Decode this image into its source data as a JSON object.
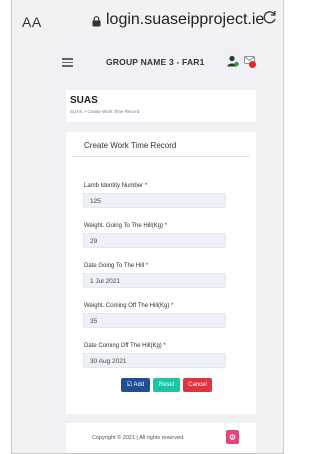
{
  "browser": {
    "aa_label": "AA",
    "url": "login.suaseipproject.ie"
  },
  "header": {
    "group_name": "GROUP NAME 3 -  FAR1"
  },
  "title_card": {
    "app_title": "SUAS",
    "breadcrumb": "SUAS   >  Create Work Time Record"
  },
  "form": {
    "title": "Create Work Time Record",
    "fields": [
      {
        "label": "Lamb Identity Number *",
        "value": "125"
      },
      {
        "label": "Weight. Going To The Hill(Kg) *",
        "value": "29"
      },
      {
        "label": "Date Going To The Hill *",
        "value": "1 Jul 2021"
      },
      {
        "label": "Weight. Coming Off The Hill(Kg) *",
        "value": "35"
      },
      {
        "label": "Date Coming Off The Hill(Kg) *",
        "value": "30 Aug 2021"
      }
    ],
    "buttons": {
      "add": "☑ Add",
      "reset": "Reset",
      "cancel": "Cancel"
    }
  },
  "footer": {
    "copyright": "Copyright © 2021 | All rights reserved."
  },
  "colors": {
    "add": "#1f4e94",
    "reset": "#1cc6a5",
    "cancel": "#e3313d",
    "footer_button": "#e2467a"
  }
}
